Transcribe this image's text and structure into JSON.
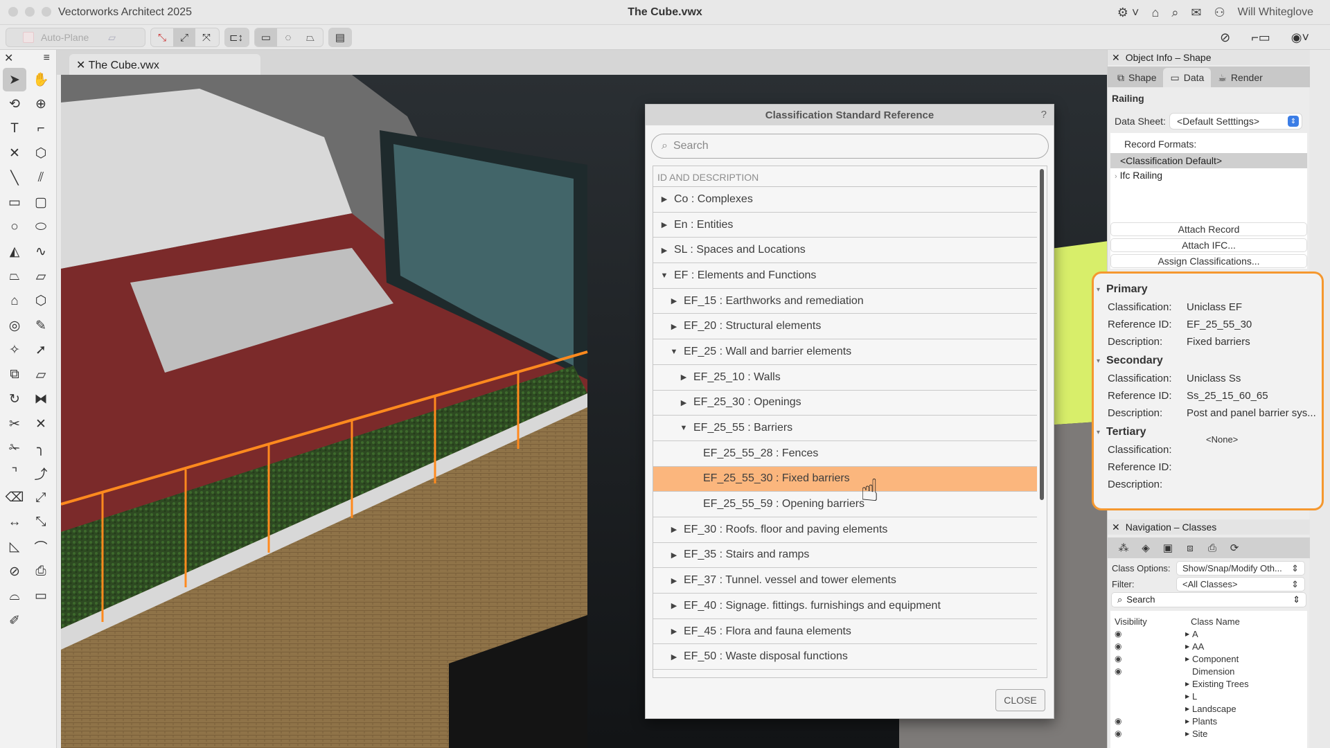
{
  "window": {
    "app_title": "Vectorworks Architect 2025",
    "doc_title": "The Cube.vwx",
    "user_name": "Will Whiteglove",
    "icons": [
      "gear-icon",
      "home-icon",
      "search-icon",
      "mail-icon",
      "user-icon"
    ]
  },
  "toolbar": {
    "auto_plane_label": "Auto-Plane",
    "right_icons": [
      "hide-icon",
      "crop-icon",
      "view-options-icon"
    ]
  },
  "palette": {
    "tools": [
      {
        "name": "selection",
        "glyph": "➤"
      },
      {
        "name": "pan",
        "glyph": "✋"
      },
      {
        "name": "flyover",
        "glyph": "⟲"
      },
      {
        "name": "zoom",
        "glyph": "⊕"
      },
      {
        "name": "text",
        "glyph": "T"
      },
      {
        "name": "callout",
        "glyph": "⌐"
      },
      {
        "name": "locus",
        "glyph": "✕"
      },
      {
        "name": "3d-locus",
        "glyph": "⬡"
      },
      {
        "name": "line",
        "glyph": "╲"
      },
      {
        "name": "double-line",
        "glyph": "⫽"
      },
      {
        "name": "rectangle",
        "glyph": "▭"
      },
      {
        "name": "rounded-rectangle",
        "glyph": "▢"
      },
      {
        "name": "circle",
        "glyph": "○"
      },
      {
        "name": "oval",
        "glyph": "⬭"
      },
      {
        "name": "arc",
        "glyph": "◭"
      },
      {
        "name": "freehand",
        "glyph": "∿"
      },
      {
        "name": "polyline",
        "glyph": "⏢"
      },
      {
        "name": "polygon",
        "glyph": "⏥"
      },
      {
        "name": "double-polygon",
        "glyph": "⌂"
      },
      {
        "name": "regular-polygon",
        "glyph": "⬡"
      },
      {
        "name": "spiral",
        "glyph": "◎"
      },
      {
        "name": "eyedropper",
        "glyph": "✎"
      },
      {
        "name": "magic-wand",
        "glyph": "✧"
      },
      {
        "name": "visibility",
        "glyph": "➚"
      },
      {
        "name": "resize",
        "glyph": "⧉"
      },
      {
        "name": "shear",
        "glyph": "▱"
      },
      {
        "name": "rotate",
        "glyph": "↻"
      },
      {
        "name": "mirror",
        "glyph": "⧓"
      },
      {
        "name": "split",
        "glyph": "✂"
      },
      {
        "name": "trim",
        "glyph": "✕"
      },
      {
        "name": "clip",
        "glyph": "✁"
      },
      {
        "name": "fillet",
        "glyph": "╮"
      },
      {
        "name": "chamfer",
        "glyph": "⌝"
      },
      {
        "name": "offset",
        "glyph": "⤴"
      },
      {
        "name": "eraser",
        "glyph": "⌫"
      },
      {
        "name": "connect",
        "glyph": "⤢"
      },
      {
        "name": "dimension",
        "glyph": "↔"
      },
      {
        "name": "angular-dimension",
        "glyph": "⤡"
      },
      {
        "name": "reshape",
        "glyph": "◺"
      },
      {
        "name": "smooth",
        "glyph": "⌒"
      },
      {
        "name": "angle",
        "glyph": "⊘"
      },
      {
        "name": "camera",
        "glyph": "⎙"
      },
      {
        "name": "arch",
        "glyph": "⌓"
      },
      {
        "name": "window-frame",
        "glyph": "▭"
      },
      {
        "name": "attribute-mapping",
        "glyph": "✐"
      }
    ]
  },
  "doc_tab": {
    "label": "The Cube.vwx"
  },
  "dialog": {
    "title": "Classification Standard Reference",
    "help": "?",
    "search_placeholder": "Search",
    "column_header": "ID AND DESCRIPTION",
    "close_label": "CLOSE",
    "rows": [
      {
        "level": 0,
        "state": "collapsed",
        "text": "Co : Complexes"
      },
      {
        "level": 0,
        "state": "collapsed",
        "text": "En : Entities"
      },
      {
        "level": 0,
        "state": "collapsed",
        "text": "SL : Spaces and Locations"
      },
      {
        "level": 0,
        "state": "expanded",
        "text": "EF : Elements and Functions"
      },
      {
        "level": 1,
        "state": "collapsed",
        "text": "EF_15 : Earthworks and remediation"
      },
      {
        "level": 1,
        "state": "collapsed",
        "text": "EF_20 : Structural elements"
      },
      {
        "level": 1,
        "state": "expanded",
        "text": "EF_25 : Wall and barrier elements"
      },
      {
        "level": 2,
        "state": "collapsed",
        "text": "EF_25_10 : Walls"
      },
      {
        "level": 2,
        "state": "collapsed",
        "text": "EF_25_30 : Openings"
      },
      {
        "level": 2,
        "state": "expanded",
        "text": "EF_25_55 : Barriers"
      },
      {
        "level": 3,
        "state": "leaf",
        "text": "EF_25_55_28 : Fences"
      },
      {
        "level": 3,
        "state": "leaf",
        "text": "EF_25_55_30 : Fixed barriers",
        "selected": true
      },
      {
        "level": 3,
        "state": "leaf",
        "text": "EF_25_55_59 : Opening barriers"
      },
      {
        "level": 1,
        "state": "collapsed",
        "text": "EF_30 : Roofs. floor and paving elements"
      },
      {
        "level": 1,
        "state": "collapsed",
        "text": "EF_35 : Stairs and ramps"
      },
      {
        "level": 1,
        "state": "collapsed",
        "text": "EF_37 : Tunnel. vessel and tower elements"
      },
      {
        "level": 1,
        "state": "collapsed",
        "text": "EF_40 : Signage. fittings. furnishings and equipment"
      },
      {
        "level": 1,
        "state": "collapsed",
        "text": "EF_45 : Flora and fauna elements"
      },
      {
        "level": 1,
        "state": "collapsed",
        "text": "EF_50 : Waste disposal functions"
      }
    ],
    "selected_color": "#fbb67d"
  },
  "object_info": {
    "title": "Object Info – Shape",
    "tabs": [
      {
        "label": "Shape"
      },
      {
        "label": "Data",
        "active": true
      },
      {
        "label": "Render"
      }
    ],
    "object_type": "Railing",
    "data_sheet_label": "Data Sheet:",
    "data_sheet_value": "<Default Setttings>",
    "record_formats_label": "Record Formats:",
    "records": [
      "<Classification Default>",
      "Ifc Railing"
    ],
    "buttons": [
      "Attach Record",
      "Attach IFC...",
      "Assign Classifications..."
    ]
  },
  "classification": {
    "highlight_color": "#f5982f",
    "labels": {
      "classification": "Classification:",
      "reference_id": "Reference ID:",
      "description": "Description:"
    },
    "primary": {
      "heading": "Primary",
      "classification": "Uniclass EF",
      "reference_id": "EF_25_55_30",
      "description": "Fixed barriers"
    },
    "secondary": {
      "heading": "Secondary",
      "classification": "Uniclass Ss",
      "reference_id": "Ss_25_15_60_65",
      "description": "Post and panel barrier sys..."
    },
    "tertiary": {
      "heading": "Tertiary",
      "classification": "<None>",
      "reference_id": "",
      "description": ""
    }
  },
  "navigation": {
    "title": "Navigation – Classes",
    "class_options_label": "Class Options:",
    "class_options_value": "Show/Snap/Modify Oth...",
    "filter_label": "Filter:",
    "filter_value": "<All Classes>",
    "search_placeholder": "Search",
    "col_visibility": "Visibility",
    "col_class_name": "Class Name",
    "classes": [
      {
        "name": "A",
        "visible": true,
        "expandable": true
      },
      {
        "name": "AA",
        "visible": true,
        "expandable": true
      },
      {
        "name": "Component",
        "visible": true,
        "expandable": true
      },
      {
        "name": "Dimension",
        "visible": true,
        "expandable": false
      },
      {
        "name": "Existing Trees",
        "visible": false,
        "expandable": true
      },
      {
        "name": "L",
        "visible": false,
        "expandable": true
      },
      {
        "name": "Landscape",
        "visible": false,
        "expandable": true
      },
      {
        "name": "Plants",
        "visible": true,
        "expandable": true
      },
      {
        "name": "Site",
        "visible": true,
        "expandable": true
      }
    ]
  }
}
